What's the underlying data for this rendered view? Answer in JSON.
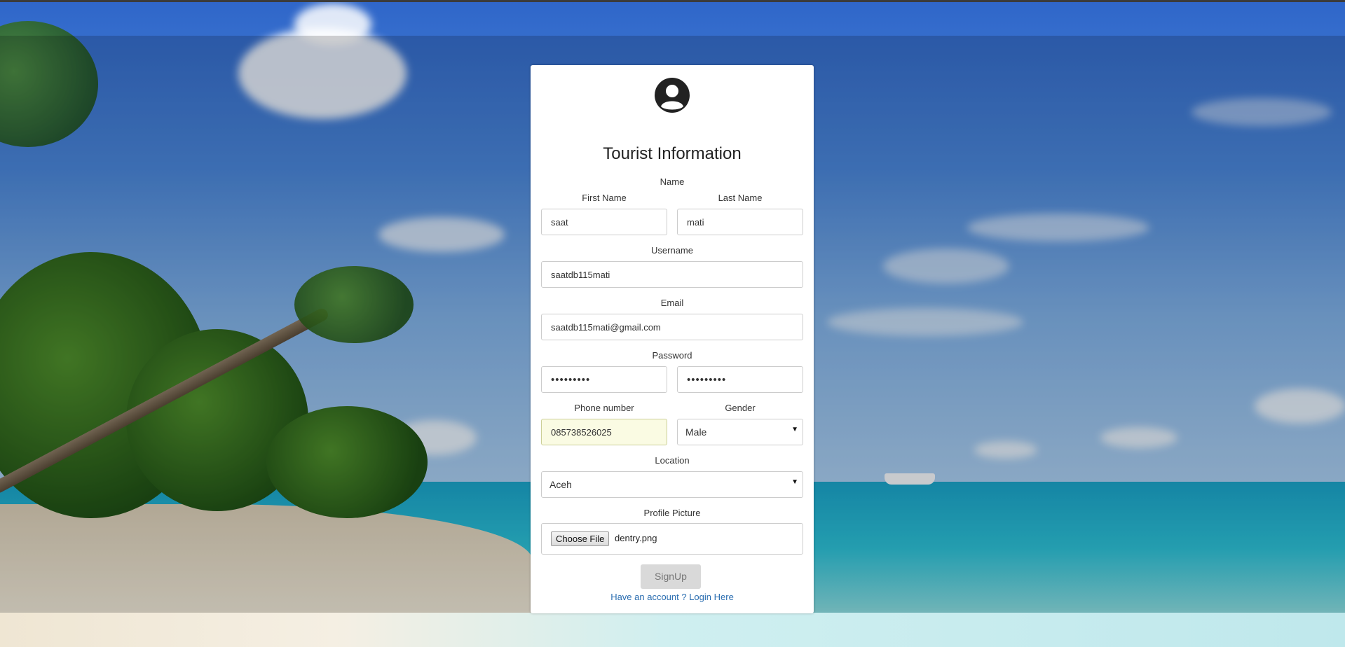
{
  "form": {
    "title": "Tourist Information",
    "name_label": "Name",
    "first_name_label": "First Name",
    "last_name_label": "Last Name",
    "first_name_value": "saat",
    "last_name_value": "mati",
    "username_label": "Username",
    "username_value": "saatdb115mati",
    "email_label": "Email",
    "email_value": "saatdb115mati@gmail.com",
    "password_label": "Password",
    "password_value": "•••••••••",
    "confirm_password_value": "•••••••••",
    "phone_label": "Phone number",
    "phone_value": "085738526025",
    "gender_label": "Gender",
    "gender_value": "Male",
    "location_label": "Location",
    "location_value": "Aceh",
    "profile_picture_label": "Profile Picture",
    "choose_file_label": "Choose File",
    "file_name": "dentry.png",
    "signup_label": "SignUp",
    "login_link": "Have an account ? Login Here"
  },
  "icons": {
    "avatar": "user-circle-icon",
    "select_caret": "caret-down-icon"
  },
  "colors": {
    "card_bg": "#ffffff",
    "link": "#2a6db0",
    "button_bg": "#d9d9d9",
    "autofill_bg": "#fafbe3"
  }
}
